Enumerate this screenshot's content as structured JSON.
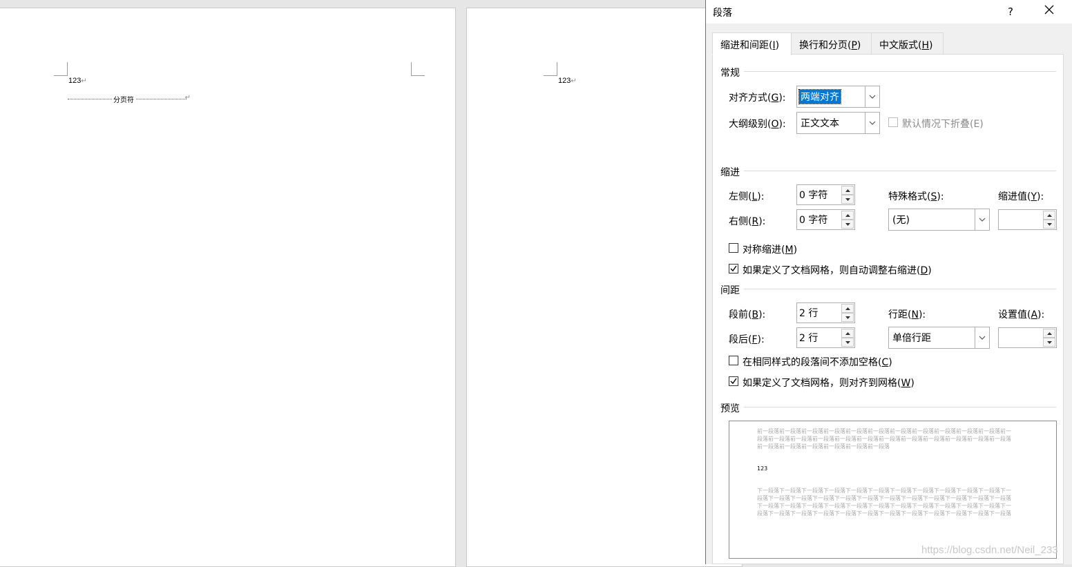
{
  "document": {
    "page1": {
      "line1": "123",
      "page_break_label": "分页符"
    },
    "page2": {
      "line1": "123"
    }
  },
  "dialog": {
    "title": "段落",
    "help": "?",
    "tabs": [
      {
        "label": "缩进和间距",
        "key": "I"
      },
      {
        "label": "换行和分页",
        "key": "P"
      },
      {
        "label": "中文版式",
        "key": "H"
      }
    ],
    "general": {
      "section": "常规",
      "alignment": {
        "label": "对齐方式",
        "key": "G",
        "value": "两端对齐"
      },
      "outline": {
        "label": "大纲级别",
        "key": "O",
        "value": "正文文本"
      },
      "collapse": {
        "label": "默认情况下折叠(E)",
        "checked": false
      }
    },
    "indent": {
      "section": "缩进",
      "left": {
        "label": "左侧",
        "key": "L",
        "value": "0 字符"
      },
      "right": {
        "label": "右侧",
        "key": "R",
        "value": "0 字符"
      },
      "special": {
        "label": "特殊格式",
        "key": "S",
        "value": "(无)"
      },
      "by": {
        "label": "缩进值",
        "key": "Y",
        "value": ""
      },
      "mirror": {
        "label": "对称缩进",
        "key": "M",
        "checked": false
      },
      "auto_adjust": {
        "label": "如果定义了文档网格，则自动调整右缩进",
        "key": "D",
        "checked": true
      }
    },
    "spacing": {
      "section": "间距",
      "before": {
        "label": "段前",
        "key": "B",
        "value": "2 行"
      },
      "after": {
        "label": "段后",
        "key": "F",
        "value": "2 行"
      },
      "line_spacing": {
        "label": "行距",
        "key": "N",
        "value": "单倍行距"
      },
      "at": {
        "label": "设置值",
        "key": "A",
        "value": ""
      },
      "no_space_same_style": {
        "label": "在相同样式的段落间不添加空格",
        "key": "C",
        "checked": false
      },
      "snap_to_grid": {
        "label": "如果定义了文档网格，则对齐到网格",
        "key": "W",
        "checked": true
      }
    },
    "preview": {
      "section": "预览",
      "prev_text": "前一段落前一段落前一段落前一段落前一段落前一段落前一段落前一段落前一段落前一段落前一段落前一段落前一段落前一段落前一段落前一段落前一段落前一段落前一段落前一段落前一段落前一段落前一段落前一段落前一段落前一段落前一段落前一段落前一段落",
      "current": "123",
      "next_text": "下一段落下一段落下一段落下一段落下一段落下一段落下一段落下一段落下一段落下一段落下一段落下一段落下一段落下一段落下一段落下一段落下一段落下一段落下一段落下一段落下一段落下一段落下一段落下一段落下一段落下一段落下一段落下一段落下一段落下一段落下一段落下一段落下一段落下一段落下一段落下一段落下一段落下一段落下一段落下一段落下一段落下一段落下一段落下一段落下一段落下一段落"
    },
    "watermark": "https://blog.csdn.net/Neil_233"
  }
}
